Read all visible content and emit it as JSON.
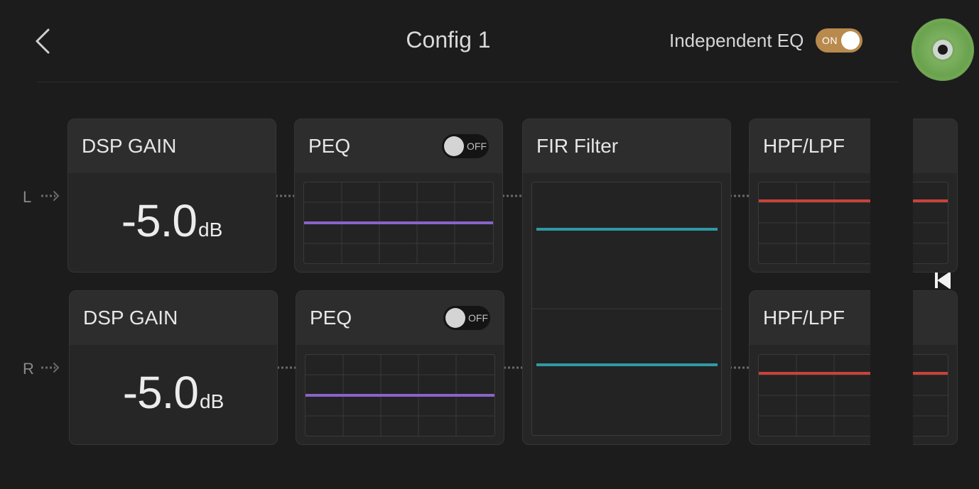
{
  "header": {
    "title": "Config 1",
    "independent_eq_label": "Independent EQ",
    "independent_eq_toggle": "ON"
  },
  "channels": {
    "left": {
      "label": "L",
      "dsp_gain": {
        "title": "DSP GAIN",
        "value": "-5.0",
        "unit": "dB"
      },
      "peq": {
        "title": "PEQ",
        "toggle": "OFF"
      },
      "hpf_lpf": {
        "title": "HPF/LPF"
      }
    },
    "right": {
      "label": "R",
      "dsp_gain": {
        "title": "DSP GAIN",
        "value": "-5.0",
        "unit": "dB"
      },
      "peq": {
        "title": "PEQ",
        "toggle": "OFF"
      },
      "hpf_lpf": {
        "title": "HPF/LPF"
      }
    }
  },
  "fir_filter": {
    "title": "FIR Filter"
  },
  "colors": {
    "peq_curve": "#8a63c9",
    "fir_curve": "#2e9aa3",
    "hpf_curve": "#c9423a",
    "toggle_on": "#b98a4e"
  },
  "icons": {
    "back": "chevron-left-icon",
    "disc": "cd-disc-icon",
    "play": "play-icon",
    "next": "skip-next-icon",
    "prev": "skip-previous-icon",
    "home": "home-icon",
    "return": "return-icon"
  }
}
